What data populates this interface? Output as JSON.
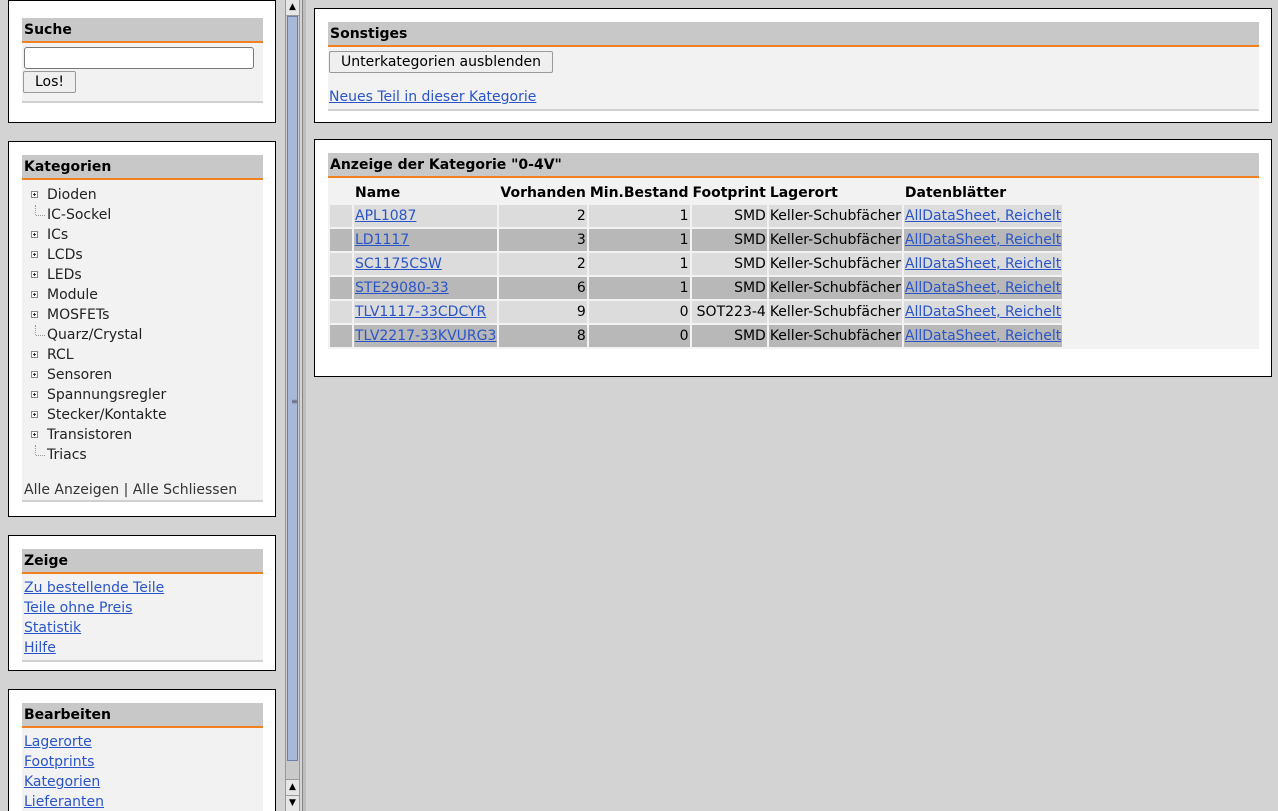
{
  "sidebar": {
    "search": {
      "title": "Suche",
      "input_value": "",
      "button_label": "Los!"
    },
    "categories": {
      "title": "Kategorien",
      "items": [
        {
          "label": "Dioden",
          "expandable": true
        },
        {
          "label": "IC-Sockel",
          "expandable": false
        },
        {
          "label": "ICs",
          "expandable": true
        },
        {
          "label": "LCDs",
          "expandable": true
        },
        {
          "label": "LEDs",
          "expandable": true
        },
        {
          "label": "Module",
          "expandable": true
        },
        {
          "label": "MOSFETs",
          "expandable": true
        },
        {
          "label": "Quarz/Crystal",
          "expandable": false
        },
        {
          "label": "RCL",
          "expandable": true
        },
        {
          "label": "Sensoren",
          "expandable": true
        },
        {
          "label": "Spannungsregler",
          "expandable": true
        },
        {
          "label": "Stecker/Kontakte",
          "expandable": true
        },
        {
          "label": "Transistoren",
          "expandable": true
        },
        {
          "label": "Triacs",
          "expandable": false
        }
      ],
      "show_all": "Alle Anzeigen",
      "separator": "|",
      "close_all": "Alle Schliessen"
    },
    "show": {
      "title": "Zeige",
      "links": [
        "Zu bestellende Teile",
        "Teile ohne Preis",
        "Statistik",
        "Hilfe"
      ]
    },
    "edit": {
      "title": "Bearbeiten",
      "links": [
        "Lagerorte",
        "Footprints",
        "Kategorien",
        "Lieferanten"
      ]
    }
  },
  "misc": {
    "title": "Sonstiges",
    "toggle_button": "Unterkategorien ausblenden",
    "new_part_link": "Neues Teil in dieser Kategorie"
  },
  "category_view": {
    "title": "Anzeige der Kategorie \"0-4V\"",
    "columns": [
      "",
      "Name",
      "Vorhanden",
      "Min.Bestand",
      "Footprint",
      "Lagerort",
      "Datenblätter"
    ],
    "rows": [
      {
        "name": "APL1087",
        "stock": "2",
        "min": "1",
        "footprint": "SMD",
        "location": "Keller-Schubfächer",
        "datasheets": "AllDataSheet, Reichelt"
      },
      {
        "name": "LD1117",
        "stock": "3",
        "min": "1",
        "footprint": "SMD",
        "location": "Keller-Schubfächer",
        "datasheets": "AllDataSheet, Reichelt"
      },
      {
        "name": "SC1175CSW",
        "stock": "2",
        "min": "1",
        "footprint": "SMD",
        "location": "Keller-Schubfächer",
        "datasheets": "AllDataSheet, Reichelt"
      },
      {
        "name": "STE29080-33",
        "stock": "6",
        "min": "1",
        "footprint": "SMD",
        "location": "Keller-Schubfächer",
        "datasheets": "AllDataSheet, Reichelt"
      },
      {
        "name": "TLV1117-33CDCYR",
        "stock": "9",
        "min": "0",
        "footprint": "SOT223-4",
        "location": "Keller-Schubfächer",
        "datasheets": "AllDataSheet, Reichelt"
      },
      {
        "name": "TLV2217-33KVURG3",
        "stock": "8",
        "min": "0",
        "footprint": "SMD",
        "location": "Keller-Schubfächer",
        "datasheets": "AllDataSheet, Reichelt"
      }
    ]
  },
  "colors": {
    "accent": "#f08020",
    "link": "#2a55c8",
    "row_light": "#dcdcdc",
    "row_dark": "#b8b8b8"
  }
}
